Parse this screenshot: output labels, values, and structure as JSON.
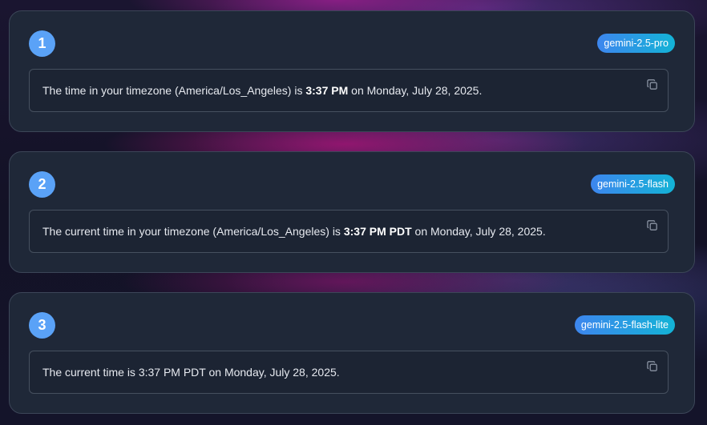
{
  "cards": [
    {
      "number": "1",
      "model": "gemini-2.5-pro",
      "text_before": "The time in your timezone (America/Los_Angeles) is ",
      "text_bold": "3:37 PM",
      "text_after": " on Monday, July 28, 2025.",
      "copy_icon": "copy-icon"
    },
    {
      "number": "2",
      "model": "gemini-2.5-flash",
      "text_before": "The current time in your timezone (America/Los_Angeles) is ",
      "text_bold": "3:37 PM PDT",
      "text_after": " on Monday, July 28, 2025.",
      "copy_icon": "copy-icon"
    },
    {
      "number": "3",
      "model": "gemini-2.5-flash-lite",
      "text_before": "The current time is 3:37 PM PDT on Monday, July 28, 2025.",
      "text_bold": "",
      "text_after": "",
      "copy_icon": "copy-icon"
    }
  ],
  "colors": {
    "card_bg": "#1f2838",
    "number_badge": "#5aa2f7",
    "model_badge_start": "#3d86ee",
    "model_badge_end": "#13b3d6"
  }
}
